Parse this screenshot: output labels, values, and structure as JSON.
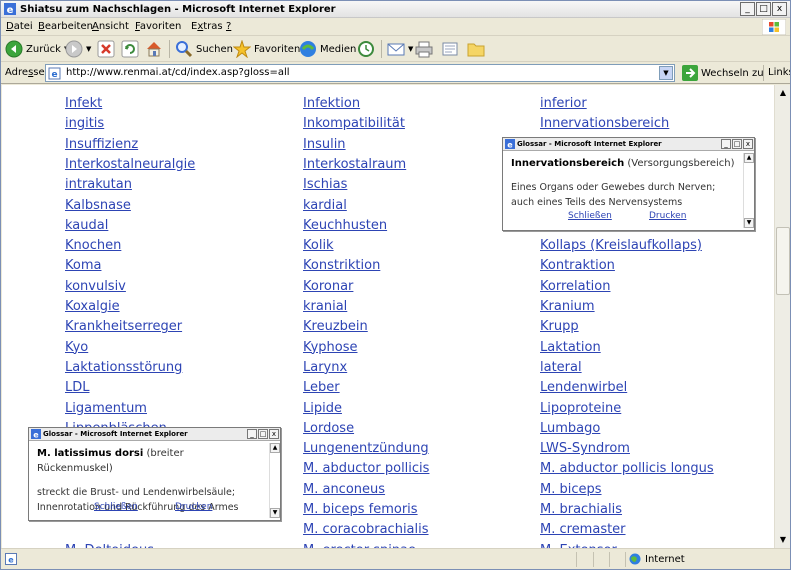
{
  "window": {
    "title": "Shiatsu zum Nachschlagen - Microsoft Internet Explorer",
    "controls": {
      "minimize": "_",
      "maximize": "□",
      "close": "x"
    }
  },
  "menu": {
    "items": [
      {
        "accel": "D",
        "rest": "atei"
      },
      {
        "accel": "B",
        "rest": "earbeiten"
      },
      {
        "accel": "A",
        "rest": "nsicht"
      },
      {
        "accel": "F",
        "rest": "avoriten"
      },
      {
        "pre": "E",
        "accel": "x",
        "rest": "tras"
      },
      {
        "accel": "?",
        "rest": ""
      }
    ]
  },
  "toolbar": {
    "back": "Zurück",
    "search": "Suchen",
    "favorites": "Favoriten",
    "media": "Medien"
  },
  "address": {
    "label_accel": "Adre",
    "label_u": "s",
    "label_rest": "se",
    "url": "http://www.renmai.at/cd/index.asp?gloss=all",
    "go": "Wechseln zu",
    "links": "Links"
  },
  "glossary": {
    "col1": [
      "Infekt",
      "ingitis",
      "Insuffizienz",
      "Interkostalneuralgie",
      "intrakutan",
      "Kalbsnase",
      "kaudal",
      "Knochen",
      "Koma",
      "konvulsiv",
      "Koxalgie",
      "Krankheitserreger",
      "Kyo",
      "Laktationsstörung",
      "LDL",
      "Ligamentum",
      "Lippenbläschen"
    ],
    "col1_last": "M. Deltoideus",
    "col2": [
      "Infektion",
      "Inkompatibilität",
      "Insulin",
      "Interkostalraum",
      "Ischias",
      "kardial",
      "Keuchhusten",
      "Kolik",
      "Konstriktion",
      "Koronar",
      "kranial",
      "Kreuzbein",
      "Kyphose",
      "Larynx",
      "Leber",
      "Lipide",
      "Lordose",
      "Lungenentzündung",
      "M. abductor pollicis",
      "M. anconeus",
      "M. biceps femoris",
      "M. coracobrachialis",
      "M. erector spinae"
    ],
    "col3_top": [
      "inferior",
      "Innervationsbereich"
    ],
    "col3": [
      "Kollaps (Kreislaufkollaps)",
      "Kontraktion",
      "Korrelation",
      "Kranium",
      "Krupp",
      "Laktation",
      "lateral",
      "Lendenwirbel",
      "Lipoproteine",
      "Lumbago",
      "LWS-Syndrom",
      "M. abductor pollicis longus",
      "M. biceps",
      "M. brachialis",
      "M. cremaster",
      "M. Extensor"
    ]
  },
  "popup_top": {
    "title": "Glossar - Microsoft Internet Explorer",
    "term": "Innervationsbereich",
    "term_note": "(Versorgungsbereich)",
    "description": "Eines Organs oder Gewebes durch Nerven; auch eines Teils des Nervensystems",
    "close": "Schließen",
    "print": "Drucken"
  },
  "popup_bottom": {
    "title": "Glossar - Microsoft Internet Explorer",
    "term": "M. latissimus dorsi",
    "term_note": "(breiter Rückenmuskel)",
    "description": "streckt die Brust- und Lendenwirbelsäule; Innenrotation und Rückführung des Armes",
    "close": "Schließen",
    "print": "Drucken"
  },
  "status": {
    "zone": "Internet"
  },
  "colors": {
    "link": "#2d44b4",
    "chrome": "#ece9d8"
  }
}
